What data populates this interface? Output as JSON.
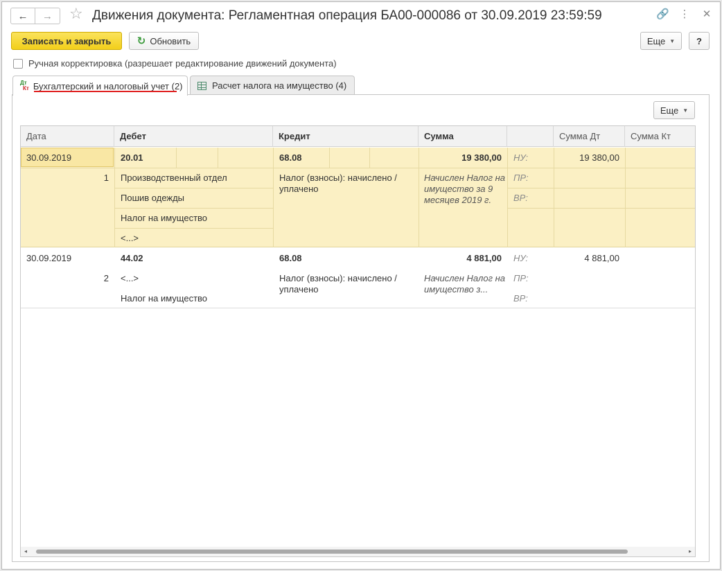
{
  "titlebar": {
    "title": "Движения документа: Регламентная операция БА00-000086 от 30.09.2019 23:59:59",
    "back_icon": "←",
    "forward_icon": "→",
    "star_icon": "☆",
    "link_icon": "🔗",
    "menu_icon": "⋮",
    "close_icon": "✕"
  },
  "toolbar": {
    "save_close_label": "Записать и закрыть",
    "refresh_label": "Обновить",
    "more_label": "Еще",
    "help_label": "?"
  },
  "checkbox": {
    "label": "Ручная корректировка (разрешает редактирование движений документа)"
  },
  "tabs": [
    {
      "label": "Бухгалтерский и налоговый учет (2)",
      "icon_dt": "Дт",
      "icon_kt": "Кт"
    },
    {
      "label": "Расчет налога на имущество (4)"
    }
  ],
  "panel": {
    "more_label": "Еще"
  },
  "grid": {
    "columns": [
      "Дата",
      "Дебет",
      "Кредит",
      "Сумма",
      "",
      "Сумма Дт",
      "Сумма Кт"
    ],
    "rows": [
      {
        "date": "30.09.2019",
        "num": "1",
        "debit": "20.01",
        "debit_sub": [
          "Производственный отдел",
          "Пошив одежды",
          "Налог на имущество",
          "<...>"
        ],
        "credit": "68.08",
        "credit_sub": "Налог (взносы): начислено / уплачено",
        "sum": "19 380,00",
        "content": "Начислен Налог на имущество за 9 месяцев 2019 г.",
        "nu": "НУ:",
        "pr": "ПР:",
        "vr": "ВР:",
        "sum_dt": "19 380,00",
        "sum_kt": ""
      },
      {
        "date": "30.09.2019",
        "num": "2",
        "debit": "44.02",
        "debit_sub": [
          "<...>",
          "Налог на имущество"
        ],
        "credit": "68.08",
        "credit_sub": "Налог (взносы): начислено / уплачено",
        "sum": "4 881,00",
        "content": "Начислен Налог на имущество з...",
        "nu": "НУ:",
        "pr": "ПР:",
        "vr": "ВР:",
        "sum_dt": "4 881,00",
        "sum_kt": ""
      }
    ]
  },
  "scrollbar": {
    "left_icon": "◂",
    "right_icon": "▸"
  }
}
